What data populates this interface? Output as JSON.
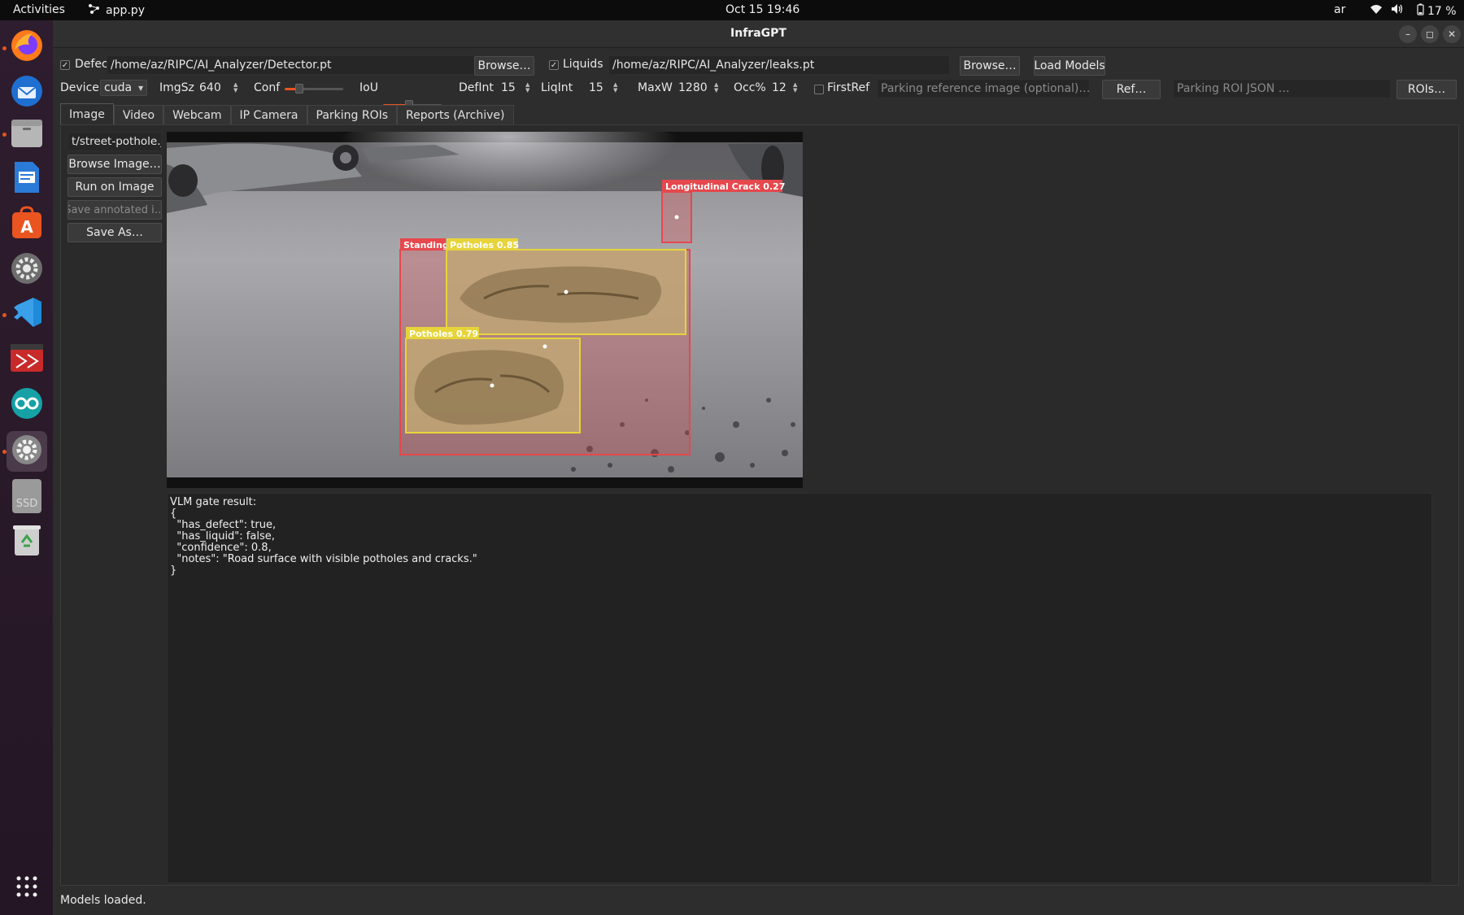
{
  "topbar": {
    "activities": "Activities",
    "app_name": "app.py",
    "datetime": "Oct 15  19:46",
    "language": "ar",
    "battery": "17 %"
  },
  "dock": {
    "items": [
      "firefox-icon",
      "thunderbird-icon",
      "files-icon",
      "writer-icon",
      "app-center-icon",
      "settings-icon",
      "vscode-icon",
      "terminal-app-icon",
      "arduino-icon",
      "settings-active-icon",
      "ssd-drive-icon",
      "trash-icon"
    ],
    "ssd_label": "SSD"
  },
  "window": {
    "title": "InfraGPT",
    "min_glyph": "–",
    "max_glyph": "◻",
    "close_glyph": "✕"
  },
  "models_row": {
    "defects_checked": true,
    "defects_label": "Defects",
    "defects_path": "/home/az/RIPC/AI_Analyzer/Detector.pt",
    "browse1": "Browse…",
    "liquids_checked": true,
    "liquids_label": "Liquids",
    "liquids_path": "/home/az/RIPC/AI_Analyzer/leaks.pt",
    "browse2": "Browse…",
    "load_models": "Load Models"
  },
  "params_row": {
    "device_label": "Device",
    "device_value": "cuda",
    "imgsz_label": "ImgSz",
    "imgsz_value": "640",
    "conf_label": "Conf",
    "conf_value": 0.25,
    "iou_label": "IoU",
    "iou_value": 0.45,
    "defint_label": "DefInt",
    "defint_value": "15",
    "liqint_label": "LiqInt",
    "liqint_value": "15",
    "maxw_label": "MaxW",
    "maxw_value": "1280",
    "occ_label": "Occ%",
    "occ_value": "12",
    "firstref_checked": false,
    "firstref_label": "FirstRef",
    "parking_ref_placeholder": "Parking reference image (optional)…",
    "ref_button": "Ref…",
    "roi_json_placeholder": "Parking ROI JSON …",
    "rois_button": "ROIs…"
  },
  "tabs": [
    "Image",
    "Video",
    "Webcam",
    "IP Camera",
    "Parking ROIs",
    "Reports (Archive)"
  ],
  "image_tab": {
    "file_field": "t/street-pothole.jpg",
    "browse_image": "Browse Image…",
    "run_on_image": "Run on Image",
    "save_annotated": "Save annotated i…",
    "save_as": "Save As…"
  },
  "detections": [
    {
      "label": "Longitudinal Crack 0.27",
      "class": "crack",
      "color": "#e5484d"
    },
    {
      "label": "Standing",
      "class": "liquid",
      "color": "#e5484d"
    },
    {
      "label": "Potholes 0.85",
      "class": "pothole",
      "color": "#e6d43a"
    },
    {
      "label": "Potholes 0.79",
      "class": "pothole",
      "color": "#e6d43a"
    }
  ],
  "output_text": "VLM gate result:\n{\n  \"has_defect\": true,\n  \"has_liquid\": false,\n  \"confidence\": 0.8,\n  \"notes\": \"Road surface with visible potholes and cracks.\"\n}",
  "status": "Models loaded."
}
